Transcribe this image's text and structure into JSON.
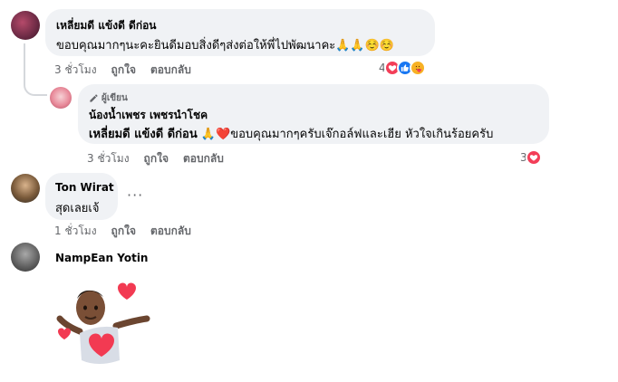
{
  "comments": [
    {
      "author": "เหลี่ยมดี แข้งดี ดีก่อน",
      "text": "ขอบคุณมากๆนะคะยินดีมอบสิ่งดีๆส่งต่อให้พี่ไปพัฒนาคะ🙏🙏☺️☺️",
      "time": "3 ชั่วโมง",
      "like_label": "ถูกใจ",
      "reply_label": "ตอบกลับ",
      "reaction_count": "4"
    },
    {
      "badge": "ผู้เขียน",
      "author": "น้องน้ำเพชร เพชรนำโชค",
      "mention": "เหลี่ยมดี แข้งดี ดีก่อน",
      "text": " 🙏❤️ขอบคุณมากๆครับเจ๊กอล์ฟและเฮีย หัวใจเกินร้อยครับ",
      "time": "3 ชั่วโมง",
      "like_label": "ถูกใจ",
      "reply_label": "ตอบกลับ",
      "reaction_count": "3"
    },
    {
      "author": "Ton Wirat",
      "text": "สุดเลยเจ้",
      "time": "1 ชั่วโมง",
      "like_label": "ถูกใจ",
      "reply_label": "ตอบกลับ",
      "more": "···"
    },
    {
      "author": "NampEan Yotin"
    }
  ],
  "colors": {
    "bubble": "#f0f2f5",
    "meta_text": "#65676b",
    "love_red": "#f33e58",
    "like_blue": "#1877f2",
    "care_yellow": "#f7b125"
  }
}
